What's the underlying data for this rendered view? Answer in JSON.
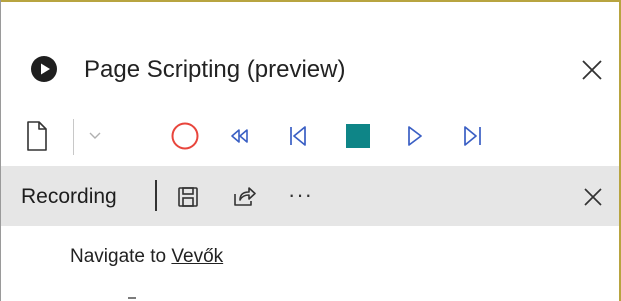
{
  "panel": {
    "title": "Page Scripting (preview)",
    "title_icon": "play-circle-icon",
    "close_icon": "close-icon"
  },
  "toolbar": {
    "buttons": [
      {
        "name": "new-script-button",
        "icon": "new-document-icon"
      },
      {
        "name": "dropdown-button",
        "icon": "chevron-down-icon"
      },
      {
        "name": "record-button",
        "icon": "record-circle-icon",
        "color": "#e8453c"
      },
      {
        "name": "rewind-button",
        "icon": "rewind-icon"
      },
      {
        "name": "step-back-button",
        "icon": "skip-back-icon"
      },
      {
        "name": "stop-button",
        "icon": "stop-square-icon",
        "color": "#0e8587"
      },
      {
        "name": "play-button",
        "icon": "play-icon"
      },
      {
        "name": "step-forward-button",
        "icon": "skip-forward-icon"
      }
    ],
    "icon_color": "#3a5fc4"
  },
  "recording_bar": {
    "label": "Recording",
    "save_icon": "save-icon",
    "share_icon": "share-icon",
    "more_label": "···",
    "close_icon": "close-icon"
  },
  "steps": [
    {
      "prefix": "Navigate to ",
      "link": "Vevők"
    }
  ]
}
